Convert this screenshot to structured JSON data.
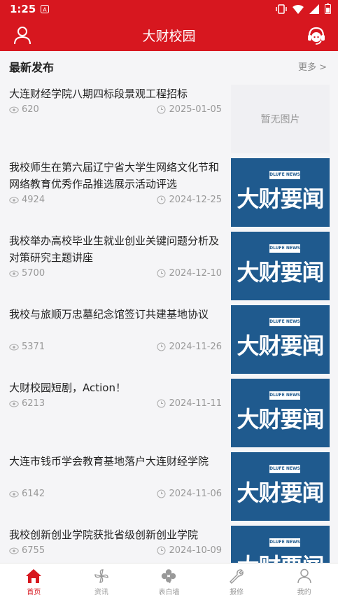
{
  "statusbar": {
    "time": "1:25",
    "icons": [
      "notification-a-icon",
      "vibrate-icon",
      "wifi-icon",
      "signal-icon",
      "battery-icon"
    ]
  },
  "appbar": {
    "title": "大财校园",
    "left_icon": "user-icon",
    "right_icon": "support-headset-icon"
  },
  "section": {
    "title": "最新发布",
    "more": "更多 >"
  },
  "items": [
    {
      "title": "大连财经学院八期四标段景观工程招标",
      "views": "620",
      "date": "2025-01-05",
      "thumb": "暂无图片"
    },
    {
      "title": "我校师生在第六届辽宁省大学生网络文化节和网络教育优秀作品推选展示活动评选",
      "views": "4924",
      "date": "2024-12-25",
      "thumb": "news"
    },
    {
      "title": "我校举办高校毕业生就业创业关键问题分析及对策研究主题讲座",
      "views": "5700",
      "date": "2024-12-10",
      "thumb": "news"
    },
    {
      "title": "我校与旅顺万忠墓纪念馆签订共建基地协议",
      "views": "5371",
      "date": "2024-11-26",
      "thumb": "news"
    },
    {
      "title": "大财校园短剧，Action！",
      "views": "6213",
      "date": "2024-11-11",
      "thumb": "news"
    },
    {
      "title": "大连市钱币学会教育基地落户大连财经学院",
      "views": "6142",
      "date": "2024-11-06",
      "thumb": "news"
    },
    {
      "title": "我校创新创业学院获批省级创新创业学院",
      "views": "6755",
      "date": "2024-10-09",
      "thumb": "news"
    }
  ],
  "news_thumb": {
    "tag": "DLUFE NEWS",
    "headline": "大财要闻"
  },
  "tabs": [
    {
      "label": "首页",
      "icon": "home-icon",
      "active": true
    },
    {
      "label": "资讯",
      "icon": "pinwheel-icon",
      "active": false
    },
    {
      "label": "表白墙",
      "icon": "clover-icon",
      "active": false
    },
    {
      "label": "报修",
      "icon": "wrench-icon",
      "active": false
    },
    {
      "label": "我的",
      "icon": "profile-icon",
      "active": false
    }
  ],
  "colors": {
    "brand": "#d7171f",
    "news_blue": "#1f5a8e",
    "muted": "#999999"
  }
}
